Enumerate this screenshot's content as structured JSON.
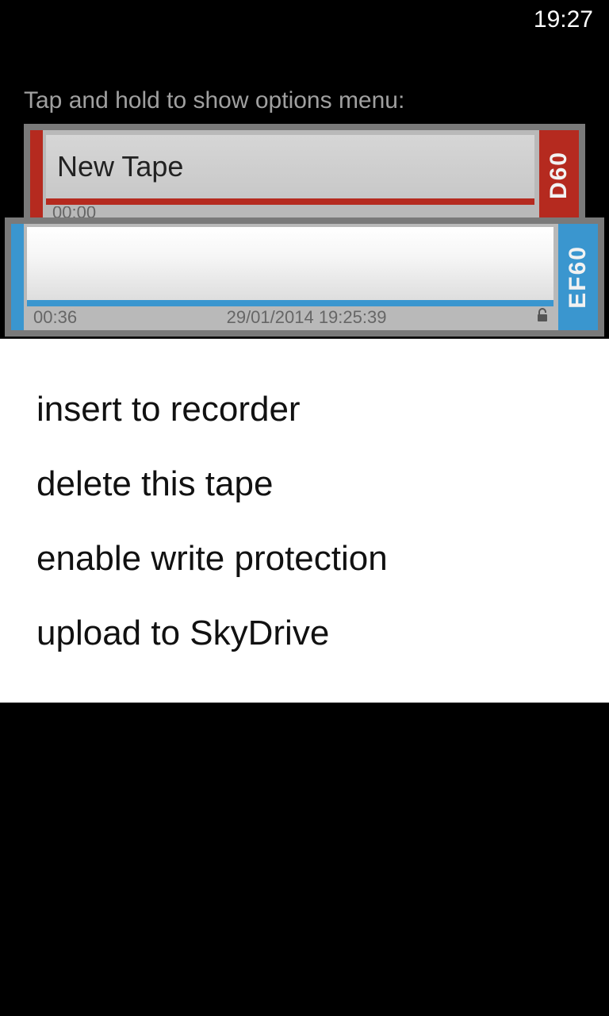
{
  "status": {
    "time": "19:27"
  },
  "instruction": "Tap and hold to show options menu:",
  "tapes": [
    {
      "label": "New Tape",
      "elapsed": "00:00",
      "type": "D60"
    },
    {
      "label": "",
      "elapsed": "00:36",
      "timestamp": "29/01/2014 19:25:39",
      "type": "EF60"
    }
  ],
  "menu": {
    "items": [
      "insert to recorder",
      "delete this tape",
      "enable write protection",
      "upload to SkyDrive"
    ]
  }
}
